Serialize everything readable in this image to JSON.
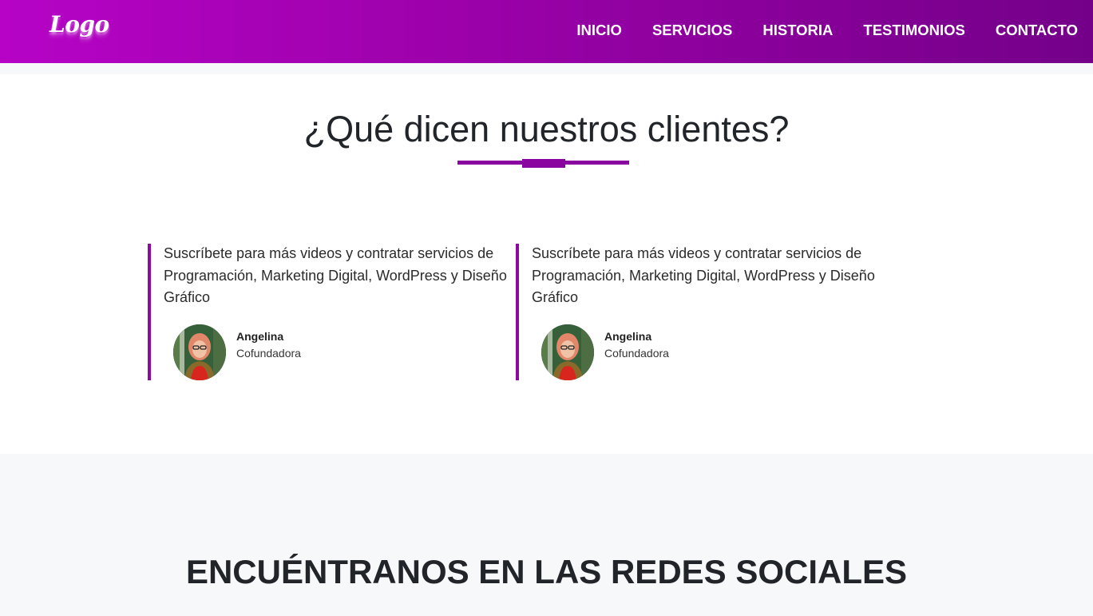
{
  "navbar": {
    "logo": "Logo",
    "links": [
      "INICIO",
      "SERVICIOS",
      "HISTORIA",
      "TESTIMONIOS",
      "CONTACTO"
    ]
  },
  "testimonials": {
    "title": "¿Qué dicen nuestros clientes?",
    "items": [
      {
        "quote": "Suscríbete para más videos y contratar servicios de Programación, Marketing Digital, WordPress y Diseño Gráfico",
        "name": "Angelina",
        "role": "Cofundadora"
      },
      {
        "quote": "Suscríbete para más videos y contratar servicios de Programación, Marketing Digital, WordPress y Diseño Gráfico",
        "name": "Angelina",
        "role": "Cofundadora"
      }
    ]
  },
  "social": {
    "title": "ENCUÉNTRANOS EN LAS REDES SOCIALES"
  },
  "colors": {
    "brand_gradient_start": "#b603c6",
    "brand_gradient_end": "#740089",
    "accent": "#8a05a0",
    "section_bg": "#f7f8f9"
  }
}
